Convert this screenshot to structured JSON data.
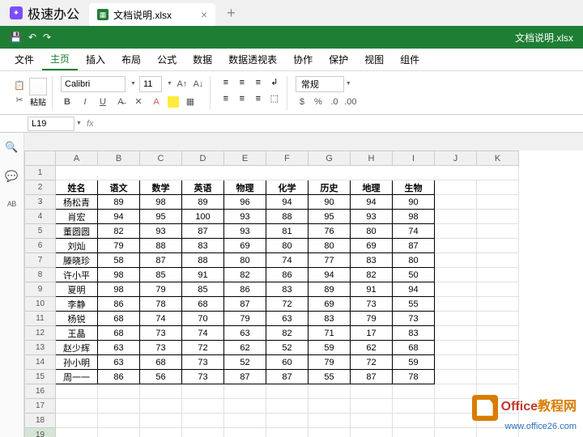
{
  "app": {
    "name": "极速办公"
  },
  "tab": {
    "filename": "文档说明.xlsx"
  },
  "titlebar": {
    "filename": "文档说明.xlsx"
  },
  "menu": {
    "file": "文件",
    "home": "主页",
    "insert": "插入",
    "layout": "布局",
    "formula": "公式",
    "data": "数据",
    "pivot": "数据透视表",
    "collab": "协作",
    "protect": "保护",
    "view": "视图",
    "component": "组件"
  },
  "ribbon": {
    "paste": "粘贴",
    "font": "Calibri",
    "size": "11",
    "format": "常规"
  },
  "namebox": {
    "ref": "L19"
  },
  "cols": [
    "A",
    "B",
    "C",
    "D",
    "E",
    "F",
    "G",
    "H",
    "I",
    "J",
    "K"
  ],
  "rows": [
    "1",
    "2",
    "3",
    "4",
    "5",
    "6",
    "7",
    "8",
    "9",
    "10",
    "11",
    "12",
    "13",
    "14",
    "15",
    "16",
    "17",
    "18",
    "19"
  ],
  "headers": [
    "姓名",
    "语文",
    "数学",
    "英语",
    "物理",
    "化学",
    "历史",
    "地理",
    "生物"
  ],
  "data": [
    [
      "杨松青",
      "89",
      "98",
      "89",
      "96",
      "94",
      "90",
      "94",
      "90"
    ],
    [
      "肖宏",
      "94",
      "95",
      "100",
      "93",
      "88",
      "95",
      "93",
      "98"
    ],
    [
      "董圆圆",
      "82",
      "93",
      "87",
      "93",
      "81",
      "76",
      "80",
      "74"
    ],
    [
      "刘灿",
      "79",
      "88",
      "83",
      "69",
      "80",
      "80",
      "69",
      "87"
    ],
    [
      "滕晓珍",
      "58",
      "87",
      "88",
      "80",
      "74",
      "77",
      "83",
      "80"
    ],
    [
      "许小平",
      "98",
      "85",
      "91",
      "82",
      "86",
      "94",
      "82",
      "50"
    ],
    [
      "夏明",
      "98",
      "79",
      "85",
      "86",
      "83",
      "89",
      "91",
      "94"
    ],
    [
      "李静",
      "86",
      "78",
      "68",
      "87",
      "72",
      "69",
      "73",
      "55"
    ],
    [
      "杨锐",
      "68",
      "74",
      "70",
      "79",
      "63",
      "83",
      "79",
      "73"
    ],
    [
      "王晶",
      "68",
      "73",
      "74",
      "63",
      "82",
      "71",
      "17",
      "83"
    ],
    [
      "赵少辉",
      "63",
      "73",
      "72",
      "62",
      "52",
      "59",
      "62",
      "68"
    ],
    [
      "孙小明",
      "63",
      "68",
      "73",
      "52",
      "60",
      "79",
      "72",
      "59"
    ],
    [
      "周一一",
      "86",
      "56",
      "73",
      "87",
      "87",
      "55",
      "87",
      "78"
    ]
  ],
  "watermark": {
    "t1a": "Office",
    "t1b": "教程网",
    "t2": "www.office26.com"
  },
  "chart_data": {
    "type": "table",
    "title": "",
    "columns": [
      "姓名",
      "语文",
      "数学",
      "英语",
      "物理",
      "化学",
      "历史",
      "地理",
      "生物"
    ],
    "rows": [
      {
        "姓名": "杨松青",
        "语文": 89,
        "数学": 98,
        "英语": 89,
        "物理": 96,
        "化学": 94,
        "历史": 90,
        "地理": 94,
        "生物": 90
      },
      {
        "姓名": "肖宏",
        "语文": 94,
        "数学": 95,
        "英语": 100,
        "物理": 93,
        "化学": 88,
        "历史": 95,
        "地理": 93,
        "生物": 98
      },
      {
        "姓名": "董圆圆",
        "语文": 82,
        "数学": 93,
        "英语": 87,
        "物理": 93,
        "化学": 81,
        "历史": 76,
        "地理": 80,
        "生物": 74
      },
      {
        "姓名": "刘灿",
        "语文": 79,
        "数学": 88,
        "英语": 83,
        "物理": 69,
        "化学": 80,
        "历史": 80,
        "地理": 69,
        "生物": 87
      },
      {
        "姓名": "滕晓珍",
        "语文": 58,
        "数学": 87,
        "英语": 88,
        "物理": 80,
        "化学": 74,
        "历史": 77,
        "地理": 83,
        "生物": 80
      },
      {
        "姓名": "许小平",
        "语文": 98,
        "数学": 85,
        "英语": 91,
        "物理": 82,
        "化学": 86,
        "历史": 94,
        "地理": 82,
        "生物": 50
      },
      {
        "姓名": "夏明",
        "语文": 98,
        "数学": 79,
        "英语": 85,
        "物理": 86,
        "化学": 83,
        "历史": 89,
        "地理": 91,
        "生物": 94
      },
      {
        "姓名": "李静",
        "语文": 86,
        "数学": 78,
        "英语": 68,
        "物理": 87,
        "化学": 72,
        "历史": 69,
        "地理": 73,
        "生物": 55
      },
      {
        "姓名": "杨锐",
        "语文": 68,
        "数学": 74,
        "英语": 70,
        "物理": 79,
        "化学": 63,
        "历史": 83,
        "地理": 79,
        "生物": 73
      },
      {
        "姓名": "王晶",
        "语文": 68,
        "数学": 73,
        "英语": 74,
        "物理": 63,
        "化学": 82,
        "历史": 71,
        "地理": 17,
        "生物": 83
      },
      {
        "姓名": "赵少辉",
        "语文": 63,
        "数学": 73,
        "英语": 72,
        "物理": 62,
        "化学": 52,
        "历史": 59,
        "地理": 62,
        "生物": 68
      },
      {
        "姓名": "孙小明",
        "语文": 63,
        "数学": 68,
        "英语": 73,
        "物理": 52,
        "化学": 60,
        "历史": 79,
        "地理": 72,
        "生物": 59
      },
      {
        "姓名": "周一一",
        "语文": 86,
        "数学": 56,
        "英语": 73,
        "物理": 87,
        "化学": 87,
        "历史": 55,
        "地理": 87,
        "生物": 78
      }
    ]
  }
}
